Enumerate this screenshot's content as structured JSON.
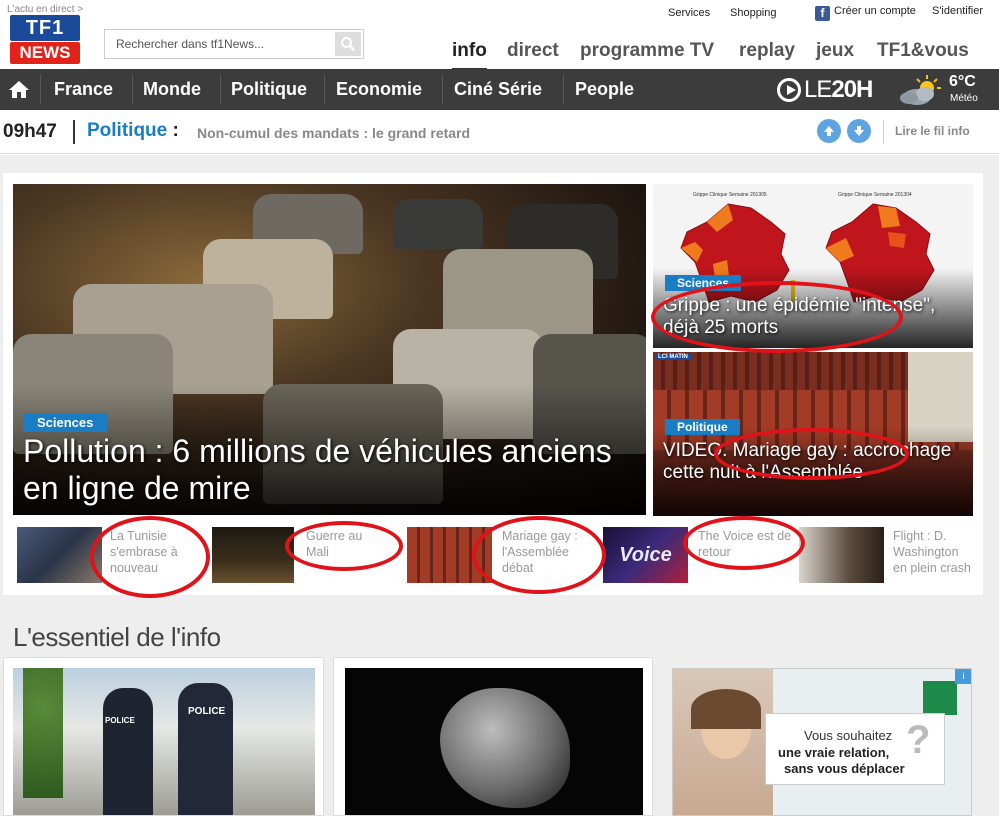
{
  "header": {
    "tagline": "L'actu en direct >",
    "logo_top": "TF1",
    "logo_bottom": "NEWS",
    "search_placeholder": "Rechercher dans tf1News...",
    "links": {
      "services": "Services",
      "shopping": "Shopping",
      "create_account": "Créer un compte",
      "login": "S'identifier"
    },
    "nav": [
      "info",
      "direct",
      "programme TV",
      "replay",
      "jeux",
      "TF1&vous"
    ]
  },
  "categories": [
    "France",
    "Monde",
    "Politique",
    "Economie",
    "Ciné Série",
    "People"
  ],
  "le20h": {
    "prefix": "LE",
    "bold": "20H"
  },
  "meteo": {
    "temp": "6°C",
    "label": "Météo"
  },
  "ticker": {
    "time": "09h47",
    "rubric": "Politique",
    "colon": ":",
    "headline": "Non-cumul des mandats : le grand retard",
    "read_label": "Lire le fil info"
  },
  "hero": {
    "tag": "Sciences",
    "title": "Pollution : 6 millions de véhicules anciens en ligne de mire"
  },
  "side1": {
    "map_title_a": "Grippe Clinique Semaine 201305",
    "map_title_b": "Grippe Clinique Semaine 201304",
    "tag": "Sciences",
    "title": "Grippe : une épidémie \"intense\", déjà 25 morts"
  },
  "side2": {
    "badge": "LCI MATIN",
    "tag": "Politique",
    "title": "VIDEO. Mariage gay : accrochage cette nuit à l'Assemblée"
  },
  "thumbs": [
    {
      "text": "La Tunisie s'embrase à nouveau"
    },
    {
      "text": "Guerre au Mali"
    },
    {
      "text": "Mariage gay : l'Assemblée débat"
    },
    {
      "text": "The Voice est de retour"
    },
    {
      "text": "Flight : D. Washington en plein crash"
    }
  ],
  "thumb_voice_text": "Voice",
  "essentiel": {
    "title": "L'essentiel de l'info",
    "police_label": "POLICE"
  },
  "ad": {
    "line1": "Vous souhaitez",
    "line2": "une vraie relation,",
    "line3": "sans vous déplacer",
    "mark": "?"
  },
  "colors": {
    "accent_blue": "#1a7dc4",
    "dark_bar": "#3c3c3c",
    "tf1_red": "#e2231a",
    "annotation_red": "#e0131a"
  }
}
